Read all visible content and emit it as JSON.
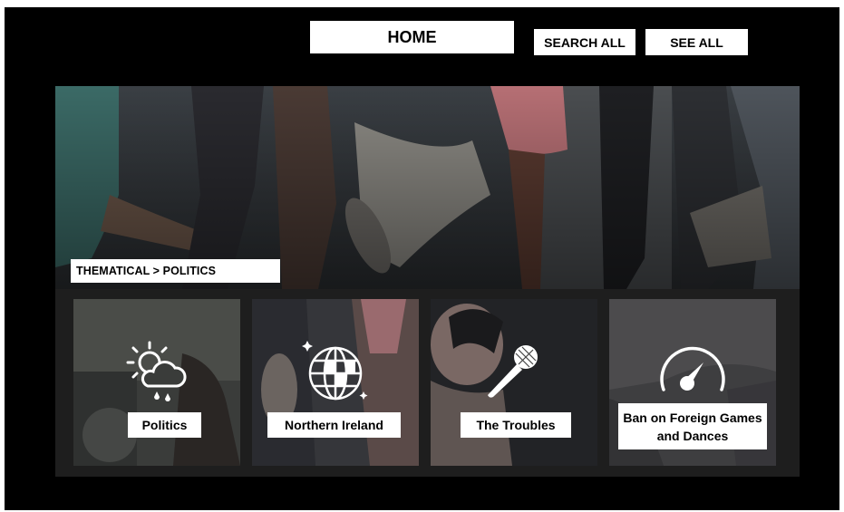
{
  "nav": {
    "home_label": "HOME",
    "search_all_label": "SEARCH ALL",
    "see_all_label": "SEE ALL"
  },
  "hero": {
    "breadcrumb": "THEMATICAL > POLITICS"
  },
  "cards": [
    {
      "label": "Politics",
      "icon": "weather-sun-cloud-rain-icon"
    },
    {
      "label": "Northern Ireland",
      "icon": "disco-ball-icon"
    },
    {
      "label": "The Troubles",
      "icon": "microphone-icon"
    },
    {
      "label": "Ban on Foreign Games and Dances",
      "icon": "speedometer-gauge-icon"
    }
  ],
  "colors": {
    "page_background": "#000000",
    "panel_background": "#262626",
    "label_background": "#ffffff",
    "icon_color": "#ffffff"
  }
}
